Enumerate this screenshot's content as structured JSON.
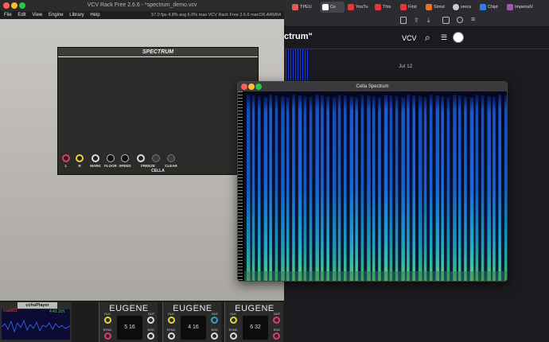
{
  "vcv": {
    "window_title": "VCV Rack Free 2.6.6 - *spectrum_demo.vcv",
    "menus": [
      "File",
      "Edit",
      "View",
      "Engine",
      "Library",
      "Help"
    ],
    "status": "57.0 fps  4.8% avg  6.0% max     VCV Rack Free 2.6.6 macOS ARM64",
    "spectrum_module": {
      "title": "SPECTRUM",
      "brand": "CELLA",
      "controls": [
        "L",
        "R",
        "MARK",
        "FLOOR",
        "SPEED",
        "FREEZE",
        "CLEAR"
      ]
    },
    "player_title": "cchoPlayer",
    "player_time": "4:41 2ch",
    "player_red": "crash01",
    "eugene_modules": [
      {
        "title": "EUGENE",
        "display": "5\n16",
        "labels": [
          "CLK",
          "SYNC",
          "OUT",
          "EOC"
        ]
      },
      {
        "title": "EUGENE",
        "display": "4\n16",
        "labels": [
          "CLK",
          "SYNC",
          "OUT",
          "EOC"
        ]
      },
      {
        "title": "EUGENE",
        "display": "6\n32",
        "labels": [
          "CLK",
          "SYNC",
          "OUT",
          "EOC"
        ]
      }
    ]
  },
  "browser": {
    "tabs": [
      {
        "label": "TPEU",
        "color": "#e05a5a"
      },
      {
        "label": "Ce",
        "color": "#ffffff"
      },
      {
        "label": "YouTu",
        "color": "#e33"
      },
      {
        "label": "This",
        "color": "#e33"
      },
      {
        "label": "First",
        "color": "#e33"
      },
      {
        "label": "Simul",
        "color": "#e8742a"
      },
      {
        "label": "vercs",
        "color": "#cccccc"
      },
      {
        "label": "Chipt",
        "color": "#2b7de9"
      },
      {
        "label": "ImperialV",
        "color": "#9b59b6"
      }
    ],
    "post_title": "ctrum\"",
    "site_name": "VCV",
    "date": "Jul 12"
  },
  "cella_window": {
    "title": "Cella Spectrum"
  }
}
